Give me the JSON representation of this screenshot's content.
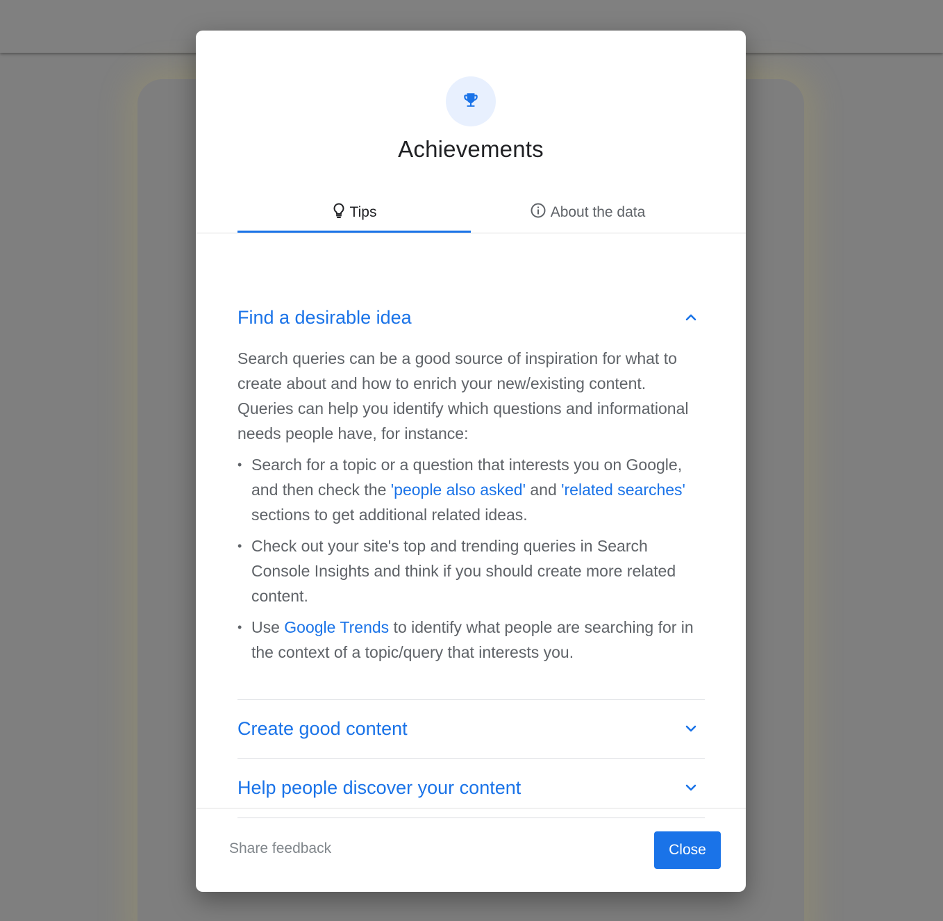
{
  "colors": {
    "accent": "#1a73e8",
    "title_text": "#202124",
    "body_text": "#5f6368",
    "icon_bg": "#e8f0fe",
    "overlay": "#7f7f7f"
  },
  "dialog": {
    "icon": "trophy-icon",
    "title": "Achievements",
    "tabs": [
      {
        "label": "Tips",
        "icon": "lightbulb-icon",
        "active": true
      },
      {
        "label": "About the data",
        "icon": "info-icon",
        "active": false
      }
    ],
    "sections": [
      {
        "title": "Find a desirable idea",
        "expanded": true,
        "intro": "Search queries can be a good source of inspiration for what to create about and how to enrich your new/existing content. Queries can help you identify which questions and informational needs people have, for instance:",
        "bullet1": {
          "pre": "Search for a topic or a question that interests you on Google, and then check the ",
          "link1": "'people also asked'",
          "mid": " and ",
          "link2": "'related searches'",
          "post": " sections to get additional related ideas."
        },
        "bullet2": "Check out your site's top and trending queries in Search Console Insights and think if you should create more related content.",
        "bullet3": {
          "pre": "Use ",
          "link": "Google Trends",
          "post": " to identify what people are searching for in the context of a topic/query that interests you."
        }
      },
      {
        "title": "Create good content",
        "expanded": false
      },
      {
        "title": "Help people discover your content",
        "expanded": false
      }
    ],
    "footer": {
      "share_feedback": "Share feedback",
      "close": "Close"
    }
  }
}
